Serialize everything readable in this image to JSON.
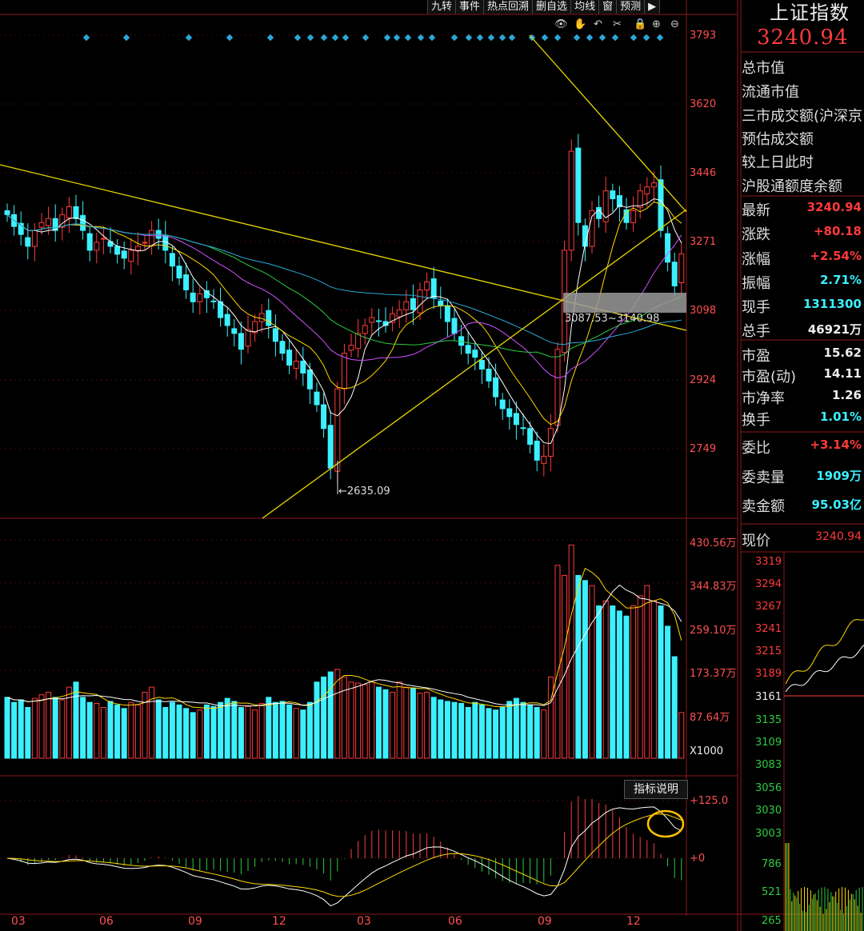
{
  "toolbar": {
    "items": [
      "九转",
      "事件",
      "热点回溯",
      "删自选",
      "均线",
      "窗",
      "预测"
    ],
    "arrow_icon": "play-arrow-icon"
  },
  "chart_icons": [
    "eye-icon",
    "hand-icon",
    "undo-icon",
    "scissors-icon",
    "lock-icon",
    "trash-icon",
    "zoom-in-icon",
    "zoom-out-icon"
  ],
  "main_chart": {
    "y_ticks": [
      "3793",
      "3620",
      "3446",
      "3271",
      "3098",
      "2924",
      "2749"
    ],
    "low_label": "←2635.09",
    "range_label": "3087.53~3140.98"
  },
  "volume_chart": {
    "y_ticks": [
      "430.56万",
      "344.83万",
      "259.10万",
      "173.37万",
      "87.64万"
    ],
    "unit": "X1000"
  },
  "indicator_chart": {
    "y_ticks": [
      "+125.0",
      "+0"
    ],
    "button": "指标说明"
  },
  "x_ticks": [
    "03",
    "06",
    "09",
    "12",
    "03",
    "06",
    "09",
    "12"
  ],
  "right_panel": {
    "title": "上证指数",
    "price": "3240.94",
    "info_lines": [
      "总市值",
      "流通市值",
      "三市成交额(沪深京",
      "预估成交额",
      "较上日此时",
      "沪股通额度余额"
    ],
    "stats": [
      {
        "label": "最新",
        "value": "3240.94",
        "color": "#ff3b3b"
      },
      {
        "label": "涨跌",
        "value": "+80.18",
        "color": "#ff3b3b"
      },
      {
        "label": "涨幅",
        "value": "+2.54%",
        "color": "#ff3b3b"
      },
      {
        "label": "振幅",
        "value": "2.71%",
        "color": "#3cf0ff"
      },
      {
        "label": "现手",
        "value": "1311300",
        "color": "#3cf0ff"
      },
      {
        "label": "总手",
        "value": "46921万",
        "color": "#eeeeee"
      }
    ],
    "stats2": [
      {
        "label": "市盈",
        "value": "15.62",
        "color": "#eeeeee"
      },
      {
        "label": "市盈(动)",
        "value": "14.11",
        "color": "#eeeeee"
      },
      {
        "label": "市净率",
        "value": "1.26",
        "color": "#eeeeee"
      },
      {
        "label": "换手",
        "value": "1.01%",
        "color": "#3cf0ff"
      }
    ],
    "stats3": [
      {
        "label": "委比",
        "value": "+3.14%",
        "color": "#ff3b3b"
      },
      {
        "label": "委卖量",
        "value": "1909万",
        "color": "#3cf0ff"
      },
      {
        "label": "卖金额",
        "value": "95.03亿",
        "color": "#3cf0ff"
      }
    ],
    "mini_label": "现价",
    "mini_value": "3240.94",
    "mini_y_ticks": [
      "3319",
      "3294",
      "3267",
      "3241",
      "3215",
      "3189",
      "3161",
      "3135",
      "3109",
      "3083",
      "3056",
      "3030",
      "3003"
    ],
    "mini_vol_ticks": [
      "786",
      "521",
      "265"
    ]
  },
  "chart_data": {
    "type": "candlestick",
    "price_ylim": [
      2650,
      3800
    ],
    "closes": [
      3340,
      3310,
      3290,
      3260,
      3300,
      3320,
      3330,
      3300,
      3340,
      3360,
      3330,
      3300,
      3250,
      3270,
      3280,
      3260,
      3240,
      3230,
      3250,
      3260,
      3270,
      3300,
      3280,
      3250,
      3210,
      3180,
      3150,
      3120,
      3140,
      3130,
      3120,
      3080,
      3060,
      3040,
      3000,
      3050,
      3070,
      3090,
      3060,
      3020,
      2990,
      2960,
      2970,
      2940,
      2900,
      2860,
      2800,
      2700,
      2900,
      2990,
      3010,
      3040,
      3060,
      3080,
      3070,
      3060,
      3090,
      3100,
      3120,
      3100,
      3150,
      3170,
      3130,
      3110,
      3070,
      3040,
      3010,
      2990,
      2980,
      2950,
      2920,
      2880,
      2850,
      2830,
      2810,
      2800,
      2760,
      2720,
      2730,
      2800,
      3000,
      3250,
      3500,
      3320,
      3260,
      3350,
      3330,
      3400,
      3380,
      3360,
      3320,
      3350,
      3400,
      3410,
      3420,
      3300,
      3220,
      3160,
      3241
    ],
    "volumes": [
      120,
      110,
      115,
      100,
      118,
      125,
      130,
      120,
      115,
      140,
      150,
      120,
      110,
      108,
      100,
      112,
      105,
      98,
      110,
      105,
      130,
      140,
      115,
      100,
      110,
      105,
      98,
      90,
      95,
      105,
      102,
      110,
      118,
      112,
      100,
      102,
      95,
      108,
      120,
      110,
      112,
      105,
      98,
      95,
      110,
      150,
      160,
      170,
      175,
      160,
      150,
      148,
      145,
      150,
      140,
      135,
      130,
      150,
      140,
      138,
      128,
      130,
      120,
      115,
      112,
      110,
      108,
      100,
      110,
      105,
      98,
      95,
      100,
      112,
      118,
      110,
      105,
      100,
      95,
      160,
      380,
      360,
      420,
      360,
      350,
      340,
      300,
      310,
      300,
      290,
      280,
      300,
      320,
      340,
      310,
      300,
      260,
      200,
      90
    ],
    "macd_ylim": [
      -50,
      130
    ],
    "low_value": 2635.09,
    "range_low": 3087.53,
    "range_high": 3140.98
  }
}
